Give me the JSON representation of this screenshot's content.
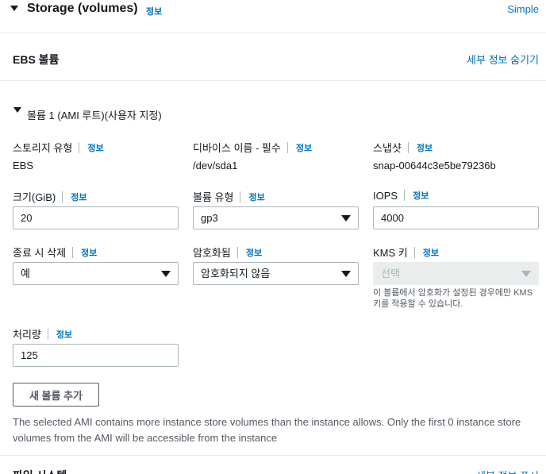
{
  "section": {
    "title": "Storage (volumes)",
    "info": "정보",
    "simple_link": "Simple"
  },
  "ebs": {
    "title": "EBS 볼륨",
    "hide_details": "세부 정보 숨기기"
  },
  "volume": {
    "title": "볼륨 1 (AMI 루트)(사용자 지정)",
    "storage_type": {
      "label": "스토리지 유형",
      "info": "정보",
      "value": "EBS"
    },
    "device_name": {
      "label": "디바이스 이름 - 필수",
      "info": "정보",
      "value": "/dev/sda1"
    },
    "snapshot": {
      "label": "스냅샷",
      "info": "정보",
      "value": "snap-00644c3e5be79236b"
    },
    "size": {
      "label": "크기(GiB)",
      "info": "정보",
      "value": "20"
    },
    "volume_type": {
      "label": "볼륨 유형",
      "info": "정보",
      "value": "gp3"
    },
    "iops": {
      "label": "IOPS",
      "info": "정보",
      "value": "4000"
    },
    "delete_on_termination": {
      "label": "종료 시 삭제",
      "info": "정보",
      "value": "예"
    },
    "encrypted": {
      "label": "암호화됨",
      "info": "정보",
      "value": "암호화되지 않음"
    },
    "kms_key": {
      "label": "KMS 키",
      "info": "정보",
      "value": "선택",
      "help": "이 볼륨에서 암호화가 설정된 경우에만 KMS 키를 적용할 수 있습니다."
    },
    "throughput": {
      "label": "처리량",
      "info": "정보",
      "value": "125"
    }
  },
  "add_volume_button": "새 볼륨 추가",
  "warning": "The selected AMI contains more instance store volumes than the instance allows. Only the first 0 instance store volumes from the AMI will be accessible from the instance",
  "file_systems": {
    "title": "파일 시스템",
    "show_details": "세부 정보 표시"
  }
}
